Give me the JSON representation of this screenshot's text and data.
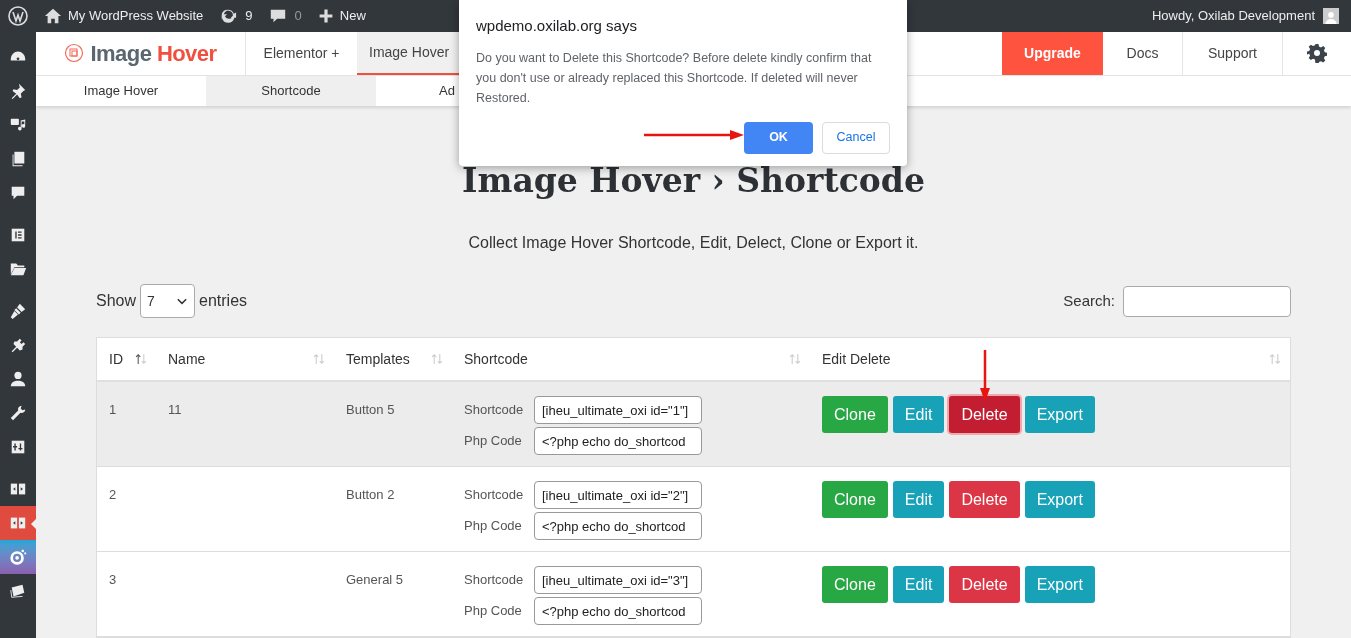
{
  "admin_bar": {
    "site_name": "My WordPress Website",
    "updates": "9",
    "comments": "0",
    "new_label": "New",
    "greeting": "Howdy, Oxilab Development"
  },
  "sidebar": {
    "items": [
      {
        "kind": "gauge",
        "selected": false
      },
      {
        "kind": "pin",
        "selected": false
      },
      {
        "kind": "media",
        "selected": false
      },
      {
        "kind": "pages",
        "selected": false
      },
      {
        "kind": "comment",
        "selected": false
      },
      {
        "kind": "elementor",
        "selected": false
      },
      {
        "kind": "folder",
        "selected": false
      },
      {
        "kind": "brush",
        "selected": false
      },
      {
        "kind": "plug",
        "selected": false
      },
      {
        "kind": "user",
        "selected": false
      },
      {
        "kind": "wrench",
        "selected": false
      },
      {
        "kind": "sliders",
        "selected": false
      },
      {
        "kind": "split",
        "selected": false
      },
      {
        "kind": "split",
        "selected": true
      },
      {
        "kind": "ring",
        "selected": false
      },
      {
        "kind": "stack",
        "selected": false
      }
    ]
  },
  "plugin_nav": {
    "logo_first": "Image",
    "logo_second": "Hover",
    "tabs": [
      {
        "label": "Elementor +",
        "selected": false
      },
      {
        "label": "Image Hover",
        "selected": true
      }
    ],
    "upgrade": "Upgrade",
    "links": [
      "Docs",
      "Support"
    ]
  },
  "sub_nav": [
    {
      "label": "Image Hover",
      "selected": false
    },
    {
      "label": "Shortcode",
      "selected": true
    },
    {
      "label": "Ad",
      "selected": false
    }
  ],
  "title": "Image Hover › Shortcode",
  "subtitle": "Collect Image Hover Shortcode, Edit, Delect, Clone or Export it.",
  "length_control": {
    "before": "Show",
    "value": "7",
    "after": "entries"
  },
  "search": {
    "label": "Search:"
  },
  "table": {
    "columns": [
      "ID",
      "Name",
      "Templates",
      "Shortcode",
      "Edit Delete"
    ],
    "rows": [
      {
        "id": "1",
        "name": "11",
        "template": "Button 5",
        "highlighted": true,
        "delete_active": true,
        "actions": [
          "Clone",
          "Edit",
          "Delete",
          "Export"
        ],
        "fields": [
          {
            "label": "Shortcode",
            "value": "[iheu_ultimate_oxi id=\"1\"]"
          },
          {
            "label": "Php Code",
            "value": "<?php echo do_shortcod"
          }
        ]
      },
      {
        "id": "2",
        "name": "",
        "template": "Button 2",
        "highlighted": false,
        "delete_active": false,
        "actions": [
          "Clone",
          "Edit",
          "Delete",
          "Export"
        ],
        "fields": [
          {
            "label": "Shortcode",
            "value": "[iheu_ultimate_oxi id=\"2\"]"
          },
          {
            "label": "Php Code",
            "value": "<?php echo do_shortcod"
          }
        ]
      },
      {
        "id": "3",
        "name": "",
        "template": "General 5",
        "highlighted": false,
        "delete_active": false,
        "actions": [
          "Clone",
          "Edit",
          "Delete",
          "Export"
        ],
        "fields": [
          {
            "label": "Shortcode",
            "value": "[iheu_ultimate_oxi id=\"3\"]"
          },
          {
            "label": "Php Code",
            "value": "<?php echo do_shortcod"
          }
        ]
      }
    ]
  },
  "dialog": {
    "title": "wpdemo.oxilab.org says",
    "message": "Do you want to Delete this Shortcode? Before delete kindly confirm that you don't use or already replaced this Shortcode. If deleted will never Restored.",
    "ok": "OK",
    "cancel": "Cancel"
  }
}
